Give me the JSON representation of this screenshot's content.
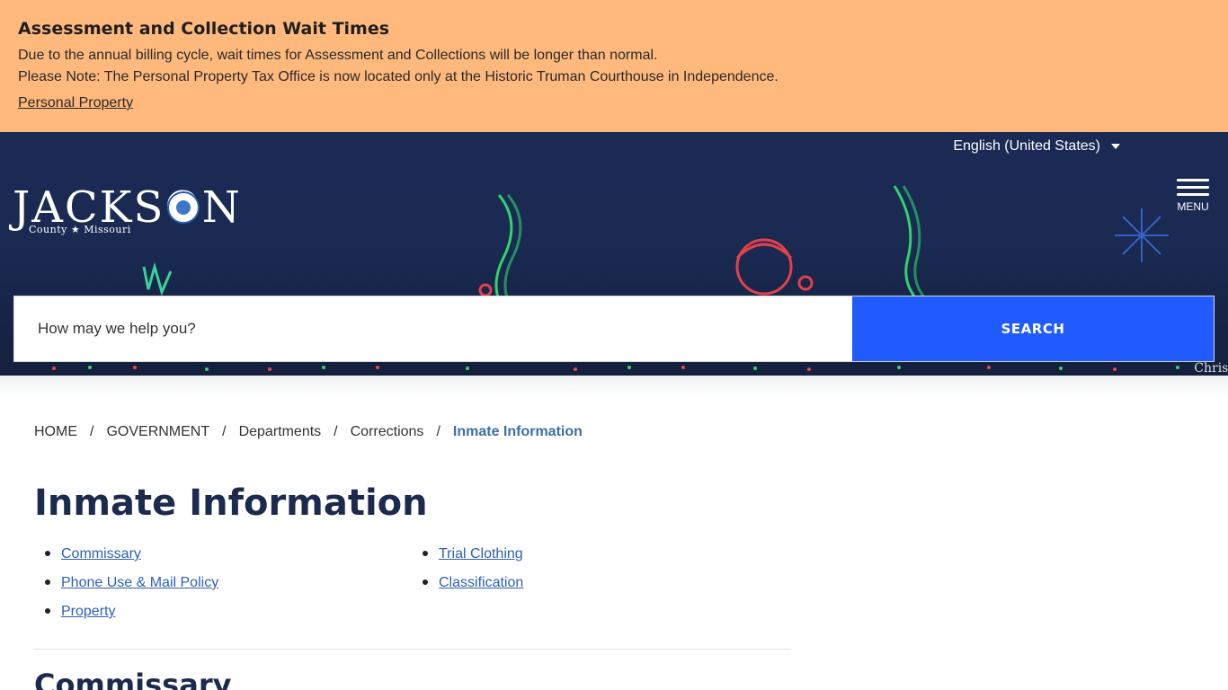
{
  "alert": {
    "title": "Assessment and Collection Wait Times",
    "line1": "Due to the annual billing cycle, wait times for Assessment and Collections will be longer than normal.",
    "line2": "Please Note: The Personal Property Tax Office is now located only at the Historic Truman Courthouse in Independence.",
    "link_label": "Personal Property",
    "background": "#ffb97d"
  },
  "header": {
    "language": "English (United States)",
    "logo_word": "JACKSON",
    "logo_sub": "County ★ Missouri",
    "menu_label": "MENU",
    "search_placeholder": "How may we help you?",
    "search_button": "SEARCH",
    "hero_caption": "Christ",
    "accent": "#1f5bff"
  },
  "breadcrumb": {
    "items": [
      "HOME",
      "GOVERNMENT",
      "Departments",
      "Corrections"
    ],
    "current": "Inmate Information"
  },
  "page": {
    "title": "Inmate Information",
    "links_col1": [
      "Commissary",
      "Phone Use & Mail Policy",
      "Property"
    ],
    "links_col2": [
      "Trial Clothing",
      "Classification"
    ],
    "section_title": "Commissary"
  }
}
